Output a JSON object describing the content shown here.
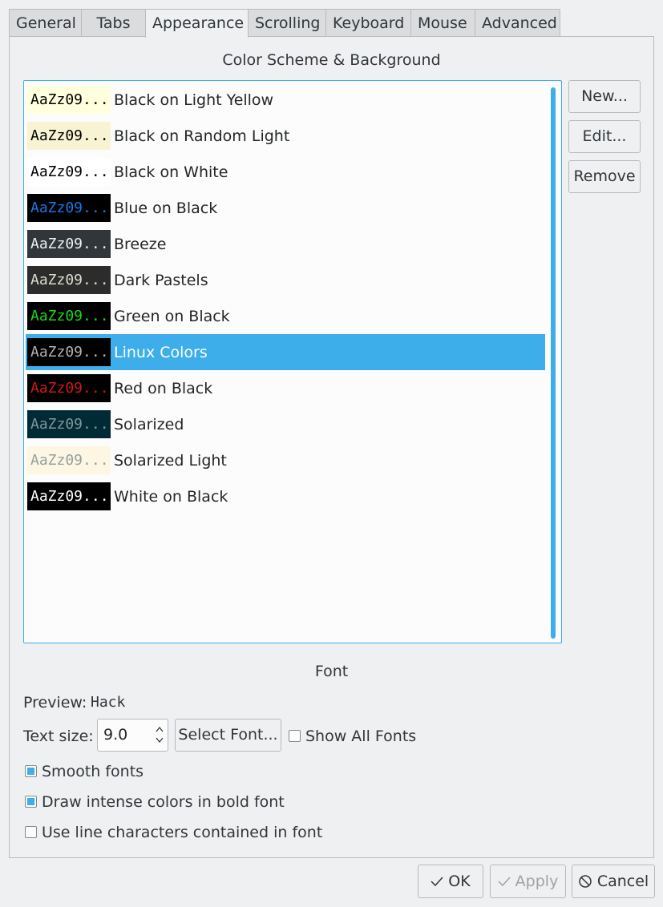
{
  "tabs": [
    {
      "label": "General"
    },
    {
      "label": "Tabs"
    },
    {
      "label": "Appearance"
    },
    {
      "label": "Scrolling"
    },
    {
      "label": "Keyboard"
    },
    {
      "label": "Mouse"
    },
    {
      "label": "Advanced"
    }
  ],
  "active_tab": "Appearance",
  "color_scheme": {
    "section_title": "Color Scheme & Background",
    "preview_text": "AaZz09...",
    "schemes": [
      {
        "name": "Black on Light Yellow",
        "bg": "#ffffdd",
        "fg": "#000000"
      },
      {
        "name": "Black on Random Light",
        "bg": "#f7f3d3",
        "fg": "#000000"
      },
      {
        "name": "Black on White",
        "bg": "#ffffff",
        "fg": "#000000"
      },
      {
        "name": "Blue on Black",
        "bg": "#000000",
        "fg": "#1877e6"
      },
      {
        "name": "Breeze",
        "bg": "#31363b",
        "fg": "#eff0f1"
      },
      {
        "name": "Dark Pastels",
        "bg": "#2c2c2c",
        "fg": "#dcdccc"
      },
      {
        "name": "Green on Black",
        "bg": "#000000",
        "fg": "#18d918"
      },
      {
        "name": "Linux Colors",
        "bg": "#000000",
        "fg": "#b2b2b2"
      },
      {
        "name": "Red on Black",
        "bg": "#000000",
        "fg": "#d01818"
      },
      {
        "name": "Solarized",
        "bg": "#002b36",
        "fg": "#839496"
      },
      {
        "name": "Solarized Light",
        "bg": "#fdf6e3",
        "fg": "#93a1a1"
      },
      {
        "name": "White on Black",
        "bg": "#000000",
        "fg": "#ffffff"
      }
    ],
    "selected": "Linux Colors",
    "buttons": {
      "new": "New...",
      "edit": "Edit...",
      "remove": "Remove"
    }
  },
  "font": {
    "section_title": "Font",
    "preview_label": "Preview:",
    "preview_font": "Hack",
    "text_size_label": "Text size:",
    "text_size_value": "9.0",
    "select_font_label": "Select Font...",
    "show_all_fonts_label": "Show All Fonts",
    "show_all_fonts_checked": false,
    "smooth_fonts_label": "Smooth fonts",
    "smooth_fonts_checked": true,
    "bold_intense_label": "Draw intense colors in bold font",
    "bold_intense_checked": true,
    "line_chars_label": "Use line characters contained in font",
    "line_chars_checked": false
  },
  "dialog_buttons": {
    "ok": "OK",
    "apply": "Apply",
    "cancel": "Cancel"
  },
  "colors": {
    "accent": "#3daee9",
    "window_bg": "#eff0f1",
    "list_bg": "#fcfcfc"
  }
}
